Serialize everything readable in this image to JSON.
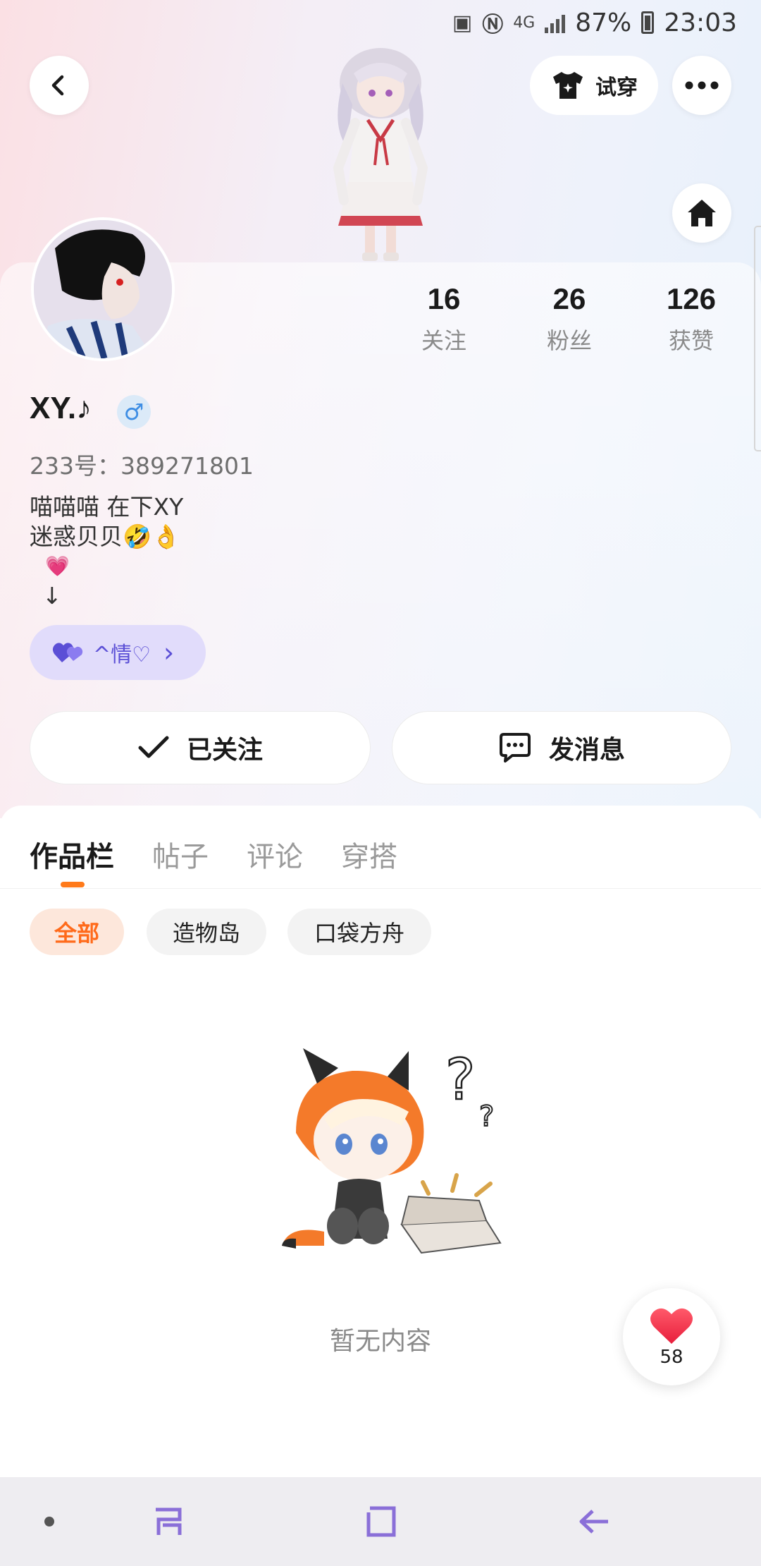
{
  "status_bar": {
    "network": "4G",
    "battery": "87%",
    "time": "23:03"
  },
  "header": {
    "back_icon": "chevron-left-icon",
    "try_on_label": "试穿",
    "more_icon": "more-dots-icon",
    "home_icon": "home-icon"
  },
  "profile": {
    "username": "XY.♪",
    "gender_symbol": "♂",
    "uid": "233号：389271801",
    "bio_line1": "喵喵喵     在下XY",
    "bio_line2": "迷惑贝贝🤣👌",
    "bio_line3": "💗",
    "bio_line4": "↓",
    "tag_label": "^情♡",
    "tag_arrow": "›"
  },
  "stats": [
    {
      "value": "16",
      "label": "关注"
    },
    {
      "value": "26",
      "label": "粉丝"
    },
    {
      "value": "126",
      "label": "获赞"
    }
  ],
  "actions": {
    "follow_label": "已关注",
    "message_label": "发消息"
  },
  "tabs": [
    "作品栏",
    "帖子",
    "评论",
    "穿搭"
  ],
  "filter_chips": [
    "全部",
    "造物岛",
    "口袋方舟"
  ],
  "empty_state": {
    "text": "暂无内容"
  },
  "like_fab": {
    "count": "58"
  },
  "colors": {
    "accent_orange": "#ff7a1a",
    "tag_purple": "#5b4fd6",
    "nav_icon": "#8a6fd8"
  }
}
